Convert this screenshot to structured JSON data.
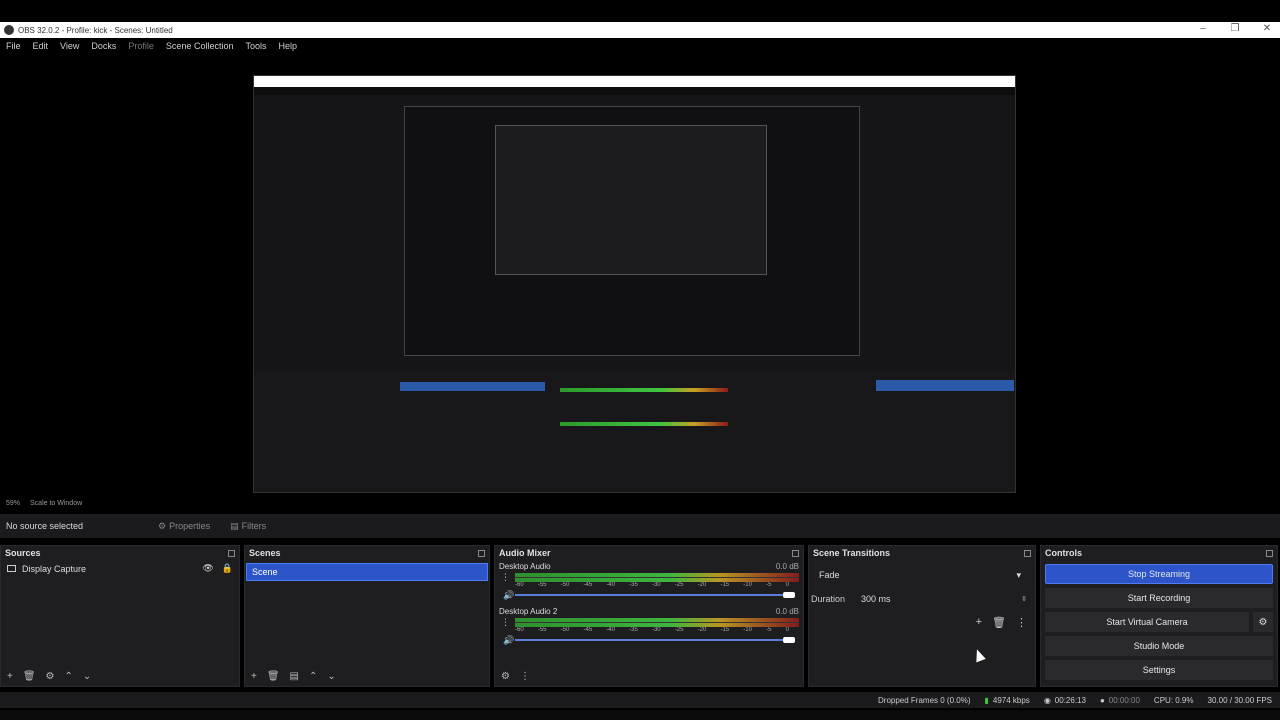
{
  "window": {
    "title": "OBS 32.0.2 - Profile: kick - Scenes: Untitled"
  },
  "menu": [
    "File",
    "Edit",
    "View",
    "Docks",
    "Profile",
    "Scene Collection",
    "Tools",
    "Help"
  ],
  "preview_status": {
    "zoom": "59%",
    "scale": "Scale to Window"
  },
  "selection": {
    "none": "No source selected",
    "properties": "Properties",
    "filters": "Filters"
  },
  "sources": {
    "title": "Sources",
    "items": [
      "Display Capture"
    ]
  },
  "scenes": {
    "title": "Scenes",
    "items": [
      "Scene"
    ]
  },
  "mixer": {
    "title": "Audio Mixer",
    "scale": [
      "-60",
      "-55",
      "-50",
      "-45",
      "-40",
      "-35",
      "-30",
      "-25",
      "-20",
      "-15",
      "-10",
      "-5",
      "0"
    ],
    "channels": [
      {
        "name": "Desktop Audio",
        "db": "0.0 dB"
      },
      {
        "name": "Desktop Audio 2",
        "db": "0.0 dB"
      }
    ]
  },
  "transitions": {
    "title": "Scene Transitions",
    "selected": "Fade",
    "duration_label": "Duration",
    "duration_value": "300 ms"
  },
  "controls": {
    "title": "Controls",
    "buttons": [
      "Stop Streaming",
      "Start Recording",
      "Start Virtual Camera",
      "Studio Mode",
      "Settings"
    ]
  },
  "status": {
    "dropped": "Dropped Frames 0 (0.0%)",
    "bitrate": "4974 kbps",
    "stream_time": "00:26:13",
    "rec_time": "00:00:00",
    "cpu": "CPU: 0.9%",
    "fps": "30.00 / 30.00 FPS"
  },
  "colors": {
    "accent": "#2d55c9",
    "meter_green": "#3fc53f",
    "meter_yellow": "#c8a020",
    "meter_red": "#8a1a1a"
  }
}
